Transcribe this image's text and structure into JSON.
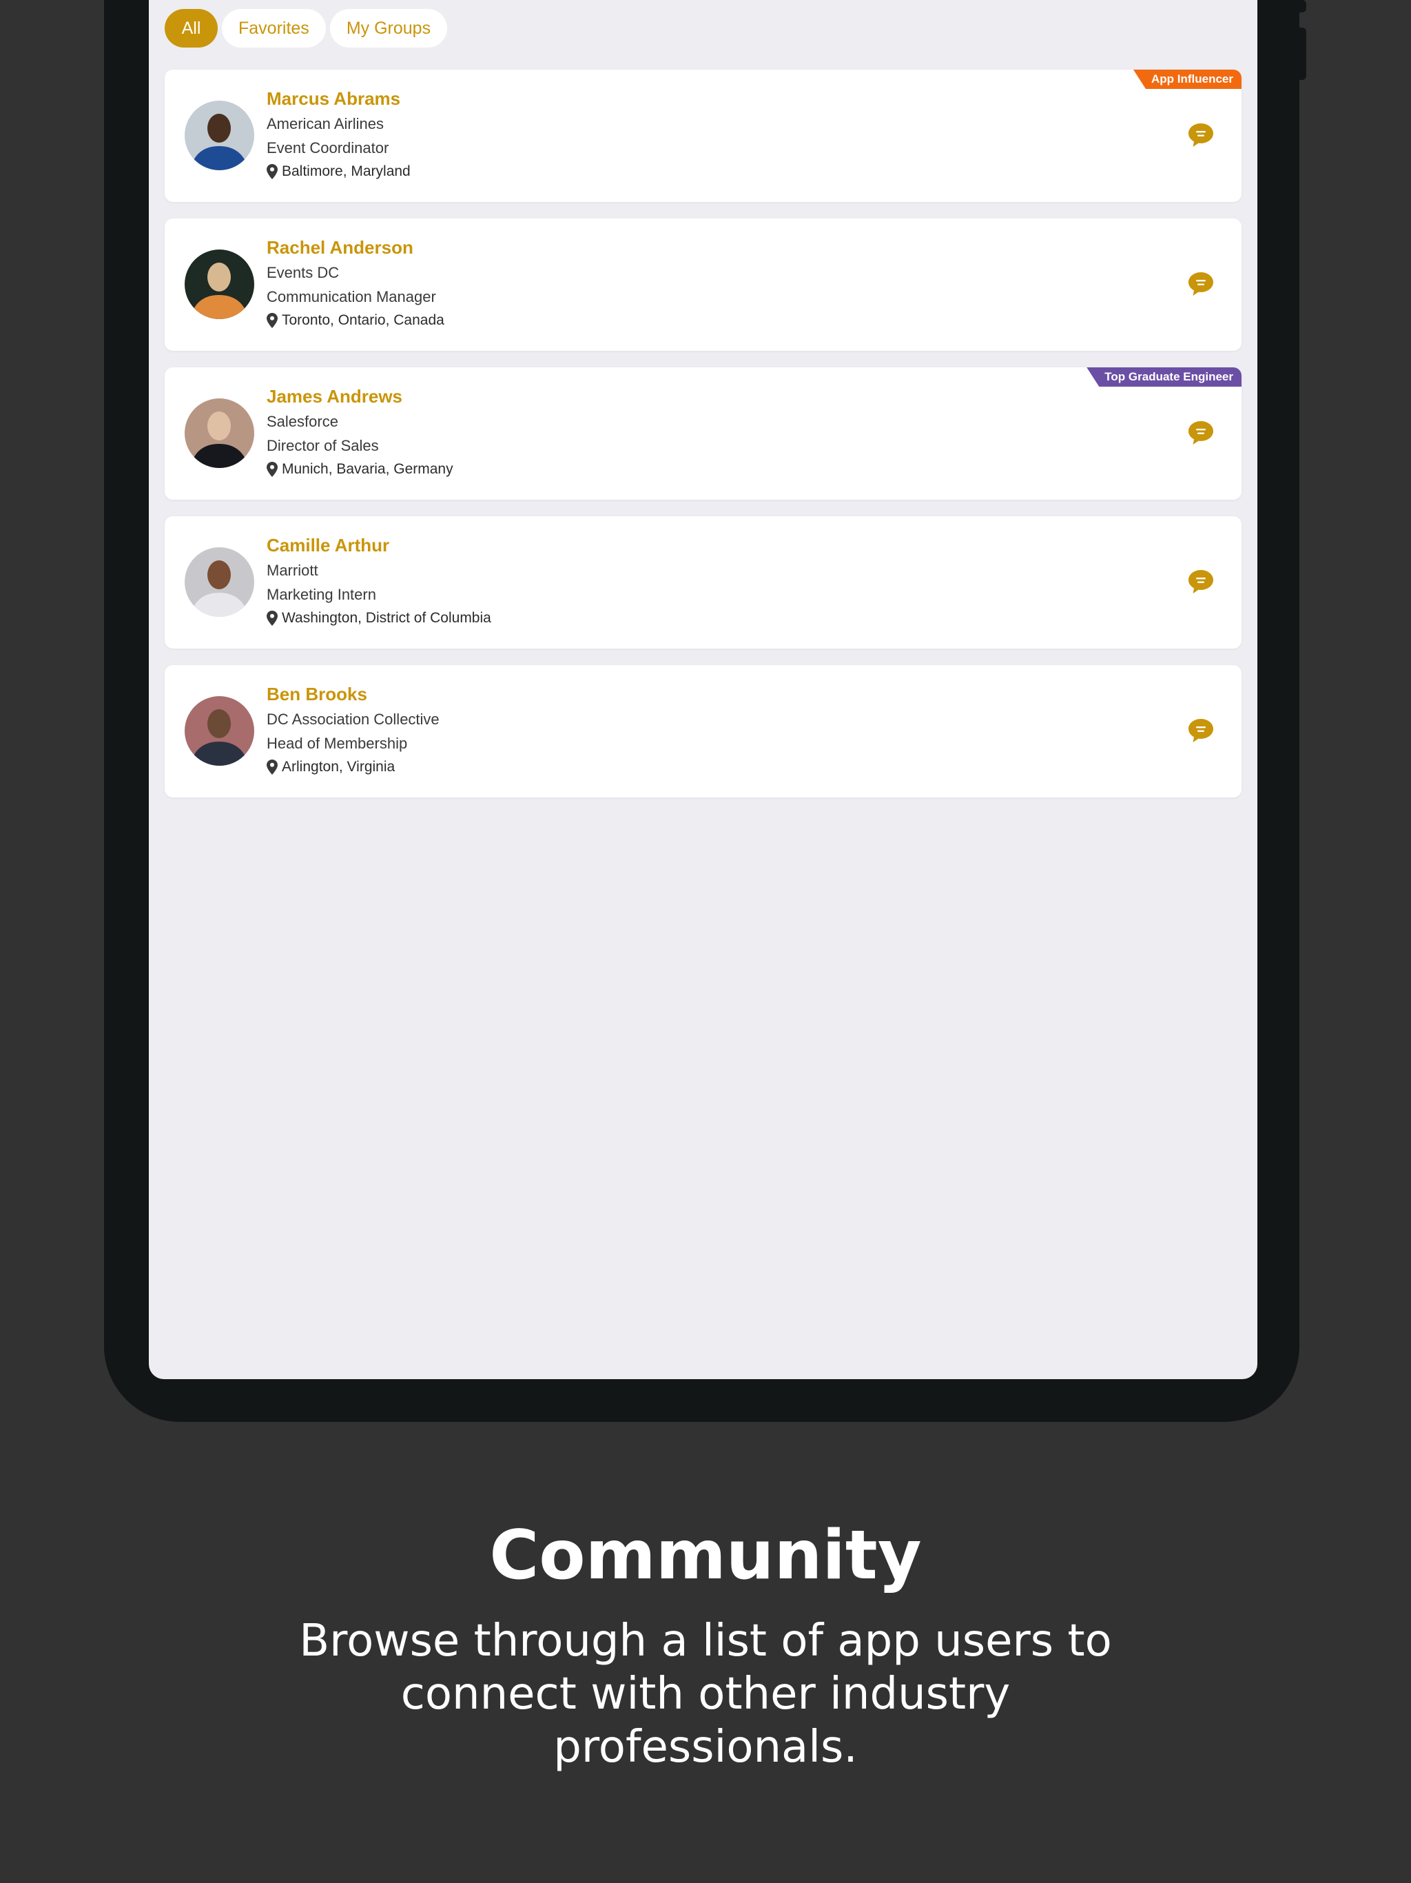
{
  "filters": {
    "all": "All",
    "favorites": "Favorites",
    "groups": "My Groups"
  },
  "people": [
    {
      "name": "Marcus Abrams",
      "company": "American Airlines",
      "title": "Event Coordinator",
      "location": "Baltimore, Maryland",
      "badge": "App Influencer",
      "badge_color": "#f26a10",
      "avatar_colors": [
        "#c4ccd4",
        "#1e4c94",
        "#4a3020"
      ]
    },
    {
      "name": "Rachel Anderson",
      "company": "Events DC",
      "title": "Communication Manager",
      "location": "Toronto, Ontario, Canada",
      "avatar_colors": [
        "#1e2a24",
        "#e08a3c",
        "#d8b890"
      ]
    },
    {
      "name": "James Andrews",
      "company": "Salesforce",
      "title": "Director of Sales",
      "location": "Munich, Bavaria, Germany",
      "badge": "Top Graduate Engineer",
      "badge_color": "#6b4fa5",
      "avatar_colors": [
        "#b89684",
        "#16181e",
        "#e0c0a4"
      ]
    },
    {
      "name": "Camille Arthur",
      "company": "Marriott",
      "title": "Marketing Intern",
      "location": "Washington, District of Columbia",
      "avatar_colors": [
        "#c8c8cc",
        "#e8e8ec",
        "#7a4e34"
      ]
    },
    {
      "name": "Ben Brooks",
      "company": "DC Association Collective",
      "title": "Head of Membership",
      "location": "Arlington, Virginia",
      "avatar_colors": [
        "#a86c6c",
        "#2a3242",
        "#6b4a36"
      ]
    }
  ],
  "caption": {
    "title": "Community",
    "subtitle": "Browse through a list of app users to connect with other industry professionals."
  },
  "colors": {
    "accent": "#c9950a",
    "background": "#323232",
    "screen": "#eeedf2"
  },
  "icons": {
    "location": "map-pin-icon",
    "message": "chat-bubble-icon"
  }
}
